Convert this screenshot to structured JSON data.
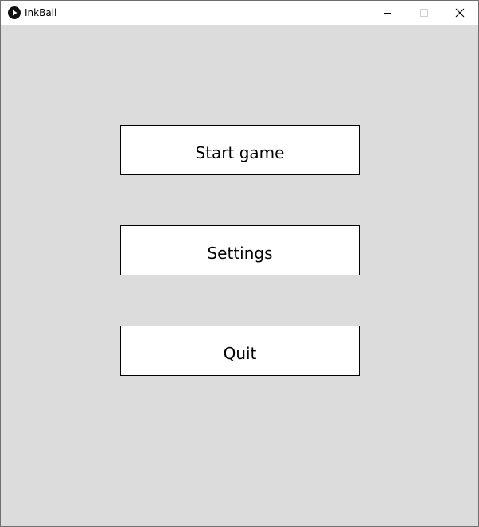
{
  "window": {
    "title": "InkBall",
    "icon": "play-icon",
    "controls": {
      "minimize_icon": "minimize-icon",
      "maximize_icon": "maximize-icon",
      "close_icon": "close-icon"
    }
  },
  "menu": {
    "start_label": "Start game",
    "settings_label": "Settings",
    "quit_label": "Quit"
  },
  "colors": {
    "background": "#dcdcdc",
    "button_fill": "#ffffff",
    "button_border": "#000000",
    "titlebar": "#ffffff"
  }
}
